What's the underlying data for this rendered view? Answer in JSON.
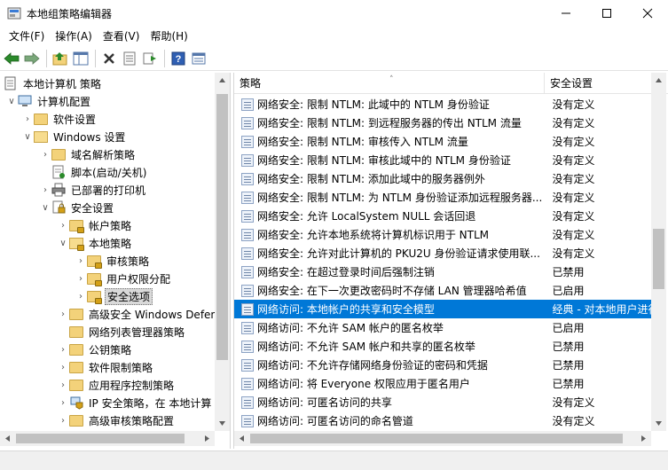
{
  "window": {
    "title": "本地组策略编辑器",
    "minimize_icon": "minimize-icon",
    "maximize_icon": "maximize-icon",
    "close_icon": "close-icon"
  },
  "menu": {
    "items": [
      "文件(F)",
      "操作(A)",
      "查看(V)",
      "帮助(H)"
    ]
  },
  "toolbar": {
    "buttons": [
      "back-arrow-icon",
      "forward-arrow-icon",
      "up-folder-icon",
      "show-hide-tree-icon",
      "delete-icon",
      "properties-icon",
      "export-list-icon",
      "help-icon",
      "view-icon"
    ]
  },
  "tree": {
    "items": [
      {
        "label": "本地计算机 策略",
        "icon": "computer-policy-icon"
      },
      {
        "label": "计算机配置",
        "icon": "computer-icon"
      },
      {
        "label": "软件设置",
        "icon": "folder-icon"
      },
      {
        "label": "Windows 设置",
        "icon": "folder-open-icon"
      },
      {
        "label": "域名解析策略",
        "icon": "folder-icon"
      },
      {
        "label": "脚本(启动/关机)",
        "icon": "script-icon"
      },
      {
        "label": "已部署的打印机",
        "icon": "printer-icon"
      },
      {
        "label": "安全设置",
        "icon": "security-settings-icon"
      },
      {
        "label": "帐户策略",
        "icon": "locked-folder-icon"
      },
      {
        "label": "本地策略",
        "icon": "locked-folder-open-icon"
      },
      {
        "label": "审核策略",
        "icon": "locked-folder-icon"
      },
      {
        "label": "用户权限分配",
        "icon": "locked-folder-icon"
      },
      {
        "label": "安全选项",
        "icon": "locked-folder-icon"
      },
      {
        "label": "高级安全 Windows Defen",
        "icon": "folder-icon"
      },
      {
        "label": "网络列表管理器策略",
        "icon": "folder-icon"
      },
      {
        "label": "公钥策略",
        "icon": "folder-icon"
      },
      {
        "label": "软件限制策略",
        "icon": "folder-icon"
      },
      {
        "label": "应用程序控制策略",
        "icon": "folder-icon"
      },
      {
        "label": "IP 安全策略，在 本地计算",
        "icon": "ip-security-icon"
      },
      {
        "label": "高级审核策略配置",
        "icon": "folder-icon"
      }
    ]
  },
  "list": {
    "columns": {
      "policy": "策略",
      "setting": "安全设置"
    },
    "rows": [
      {
        "policy": "网络安全: 限制 NTLM: 此域中的 NTLM 身份验证",
        "setting": "没有定义"
      },
      {
        "policy": "网络安全: 限制 NTLM: 到远程服务器的传出 NTLM 流量",
        "setting": "没有定义"
      },
      {
        "policy": "网络安全: 限制 NTLM: 审核传入 NTLM 流量",
        "setting": "没有定义"
      },
      {
        "policy": "网络安全: 限制 NTLM: 审核此域中的 NTLM 身份验证",
        "setting": "没有定义"
      },
      {
        "policy": "网络安全: 限制 NTLM: 添加此域中的服务器例外",
        "setting": "没有定义"
      },
      {
        "policy": "网络安全: 限制 NTLM: 为 NTLM 身份验证添加远程服务器...",
        "setting": "没有定义"
      },
      {
        "policy": "网络安全: 允许 LocalSystem NULL 会话回退",
        "setting": "没有定义"
      },
      {
        "policy": "网络安全: 允许本地系统将计算机标识用于 NTLM",
        "setting": "没有定义"
      },
      {
        "policy": "网络安全: 允许对此计算机的 PKU2U 身份验证请求使用联...",
        "setting": "没有定义"
      },
      {
        "policy": "网络安全: 在超过登录时间后强制注销",
        "setting": "已禁用"
      },
      {
        "policy": "网络安全: 在下一次更改密码时不存储 LAN 管理器哈希值",
        "setting": "已启用"
      },
      {
        "policy": "网络访问: 本地帐户的共享和安全模型",
        "setting": "经典 - 对本地用户进行"
      },
      {
        "policy": "网络访问: 不允许 SAM 帐户的匿名枚举",
        "setting": "已启用"
      },
      {
        "policy": "网络访问: 不允许 SAM 帐户和共享的匿名枚举",
        "setting": "已禁用"
      },
      {
        "policy": "网络访问: 不允许存储网络身份验证的密码和凭据",
        "setting": "已禁用"
      },
      {
        "policy": "网络访问: 将 Everyone 权限应用于匿名用户",
        "setting": "已禁用"
      },
      {
        "policy": "网络访问: 可匿名访问的共享",
        "setting": "没有定义"
      },
      {
        "policy": "网络访问: 可匿名访问的命名管道",
        "setting": "没有定义"
      }
    ]
  }
}
